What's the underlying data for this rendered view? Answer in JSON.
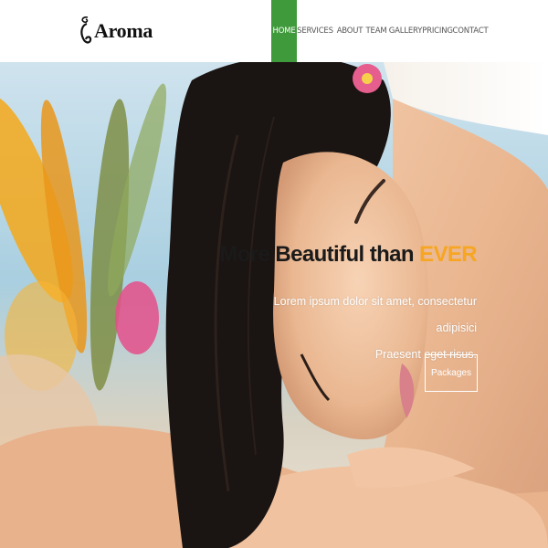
{
  "brand": {
    "logo_text": "Aroma",
    "logo_icon": "swirl-logo-icon"
  },
  "nav": {
    "items": [
      {
        "label": "HOME",
        "active": true
      },
      {
        "label": "SERVICES",
        "active": false
      },
      {
        "label": "ABOUT",
        "active": false
      },
      {
        "label": "TEAM",
        "active": false
      },
      {
        "label": "GALLERY",
        "active": false
      },
      {
        "label": "PRICING",
        "active": false
      },
      {
        "label": "CONTACT",
        "active": false
      }
    ],
    "active_color": "#3f9a3b"
  },
  "hero": {
    "title_main": "More Beautiful than ",
    "title_accent": "EVER",
    "accent_color": "#f6a623",
    "subtitle_line1": "Lorem ipsum dolor sit amet, consectetur adipisici",
    "subtitle_line2": "Praesent eget risus.",
    "button_label": "Packages"
  }
}
